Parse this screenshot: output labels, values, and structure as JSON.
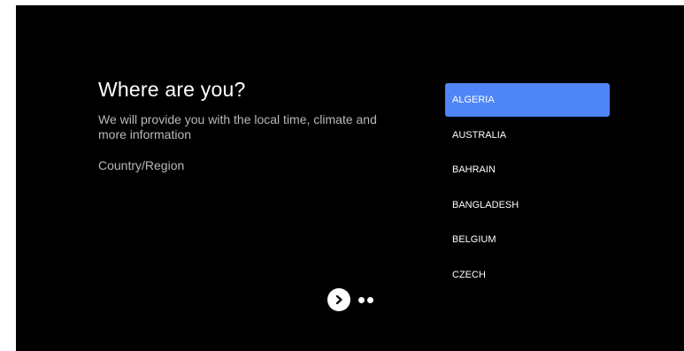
{
  "page": {
    "title": "Where are you?",
    "description": "We will provide you with the local time, climate and more information",
    "region_label": "Country/Region"
  },
  "country_list": {
    "items": [
      {
        "label": "ALGERIA",
        "selected": true
      },
      {
        "label": "AUSTRALIA",
        "selected": false
      },
      {
        "label": "BAHRAIN",
        "selected": false
      },
      {
        "label": "BANGLADESH",
        "selected": false
      },
      {
        "label": "BELGIUM",
        "selected": false
      },
      {
        "label": "CZECH",
        "selected": false
      }
    ]
  },
  "navigation": {
    "next_icon": "chevron-right-icon",
    "page_dots": 2
  },
  "colors": {
    "background": "#000000",
    "accent_selected": "#4f86f7",
    "text_primary": "#ffffff",
    "text_secondary": "#b9b9b9"
  }
}
